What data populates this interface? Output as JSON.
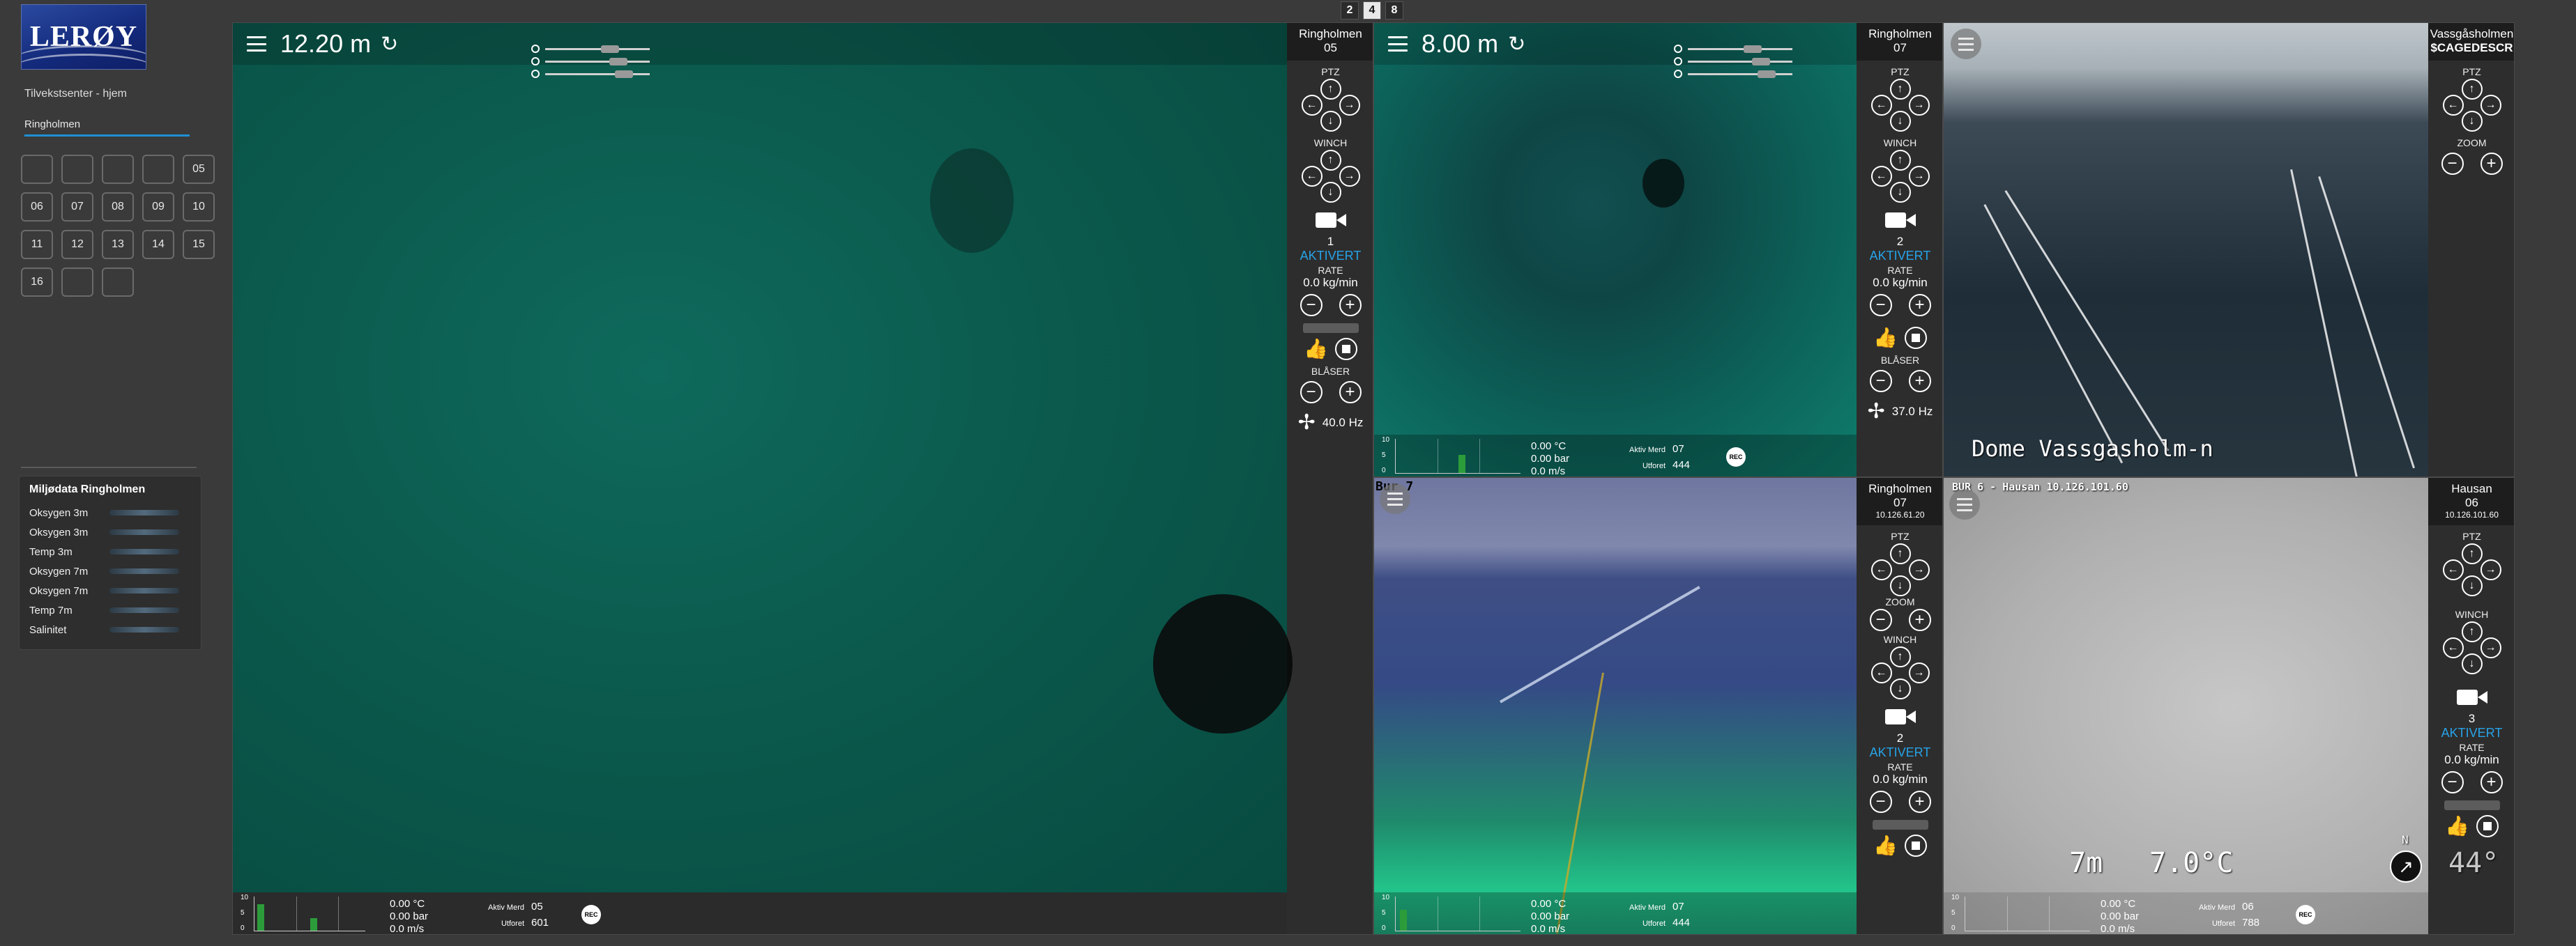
{
  "layout_buttons": [
    {
      "label": "2",
      "active": false
    },
    {
      "label": "4",
      "active": true
    },
    {
      "label": "8",
      "active": false
    }
  ],
  "sidebar": {
    "logo_text": "LERØY",
    "site_link": "Tilvekstsenter - hjem",
    "active_tab": "Ringholmen",
    "cages": [
      "",
      "",
      "",
      "",
      "05",
      "06",
      "07",
      "08",
      "09",
      "10",
      "11",
      "12",
      "13",
      "14",
      "15",
      "16",
      "",
      ""
    ],
    "env": {
      "title": "Miljødata Ringholmen",
      "rows": [
        "Oksygen 3m",
        "Oksygen 3m",
        "Temp 3m",
        "Oksygen 7m",
        "Oksygen 7m",
        "Temp 7m",
        "Salinitet"
      ]
    }
  },
  "cams": [
    {
      "depth": "12.20 m",
      "name": "Ringholmen",
      "cage": "05",
      "feed_num": "1",
      "status": "AKTIVERT",
      "rate_label": "RATE",
      "rate": "0.0 kg/min",
      "ptz_label": "PTZ",
      "winch_label": "WINCH",
      "blower_label": "BLÅSER",
      "blower_hz": "40.0 Hz",
      "temp": "0.00 °C",
      "pressure": "0.00 bar",
      "speed": "0.0 m/s",
      "mort_label": "Aktiv Merd",
      "mort_val": "05",
      "feed_label": "Utforet",
      "feed_val": "601",
      "rec": "REC"
    },
    {
      "depth": "8.00 m",
      "name": "Ringholmen",
      "cage": "07",
      "feed_num": "2",
      "status": "AKTIVERT",
      "rate_label": "RATE",
      "rate": "0.0 kg/min",
      "ptz_label": "PTZ",
      "winch_label": "WINCH",
      "blower_label": "BLÅSER",
      "blower_hz": "37.0 Hz",
      "temp": "0.00 °C",
      "pressure": "0.00 bar",
      "speed": "0.0 m/s",
      "mort_label": "Aktiv Merd",
      "mort_val": "07",
      "feed_label": "Utforet",
      "feed_val": "444",
      "rec": "REC"
    },
    {
      "name": "Vassgåsholmen",
      "sub": "$CAGEDESCR",
      "ptz_label": "PTZ",
      "zoom_label": "ZOOM",
      "osd": "Dome Vassgasholm-n"
    },
    {
      "osd": "Bur 7",
      "name": "Ringholmen",
      "cage": "07",
      "ip": "10.126.61.20",
      "ptz_label": "PTZ",
      "zoom_label": "ZOOM",
      "winch_label": "WINCH",
      "feed_num": "2",
      "status": "AKTIVERT",
      "rate_label": "RATE",
      "rate": "0.0 kg/min",
      "temp": "0.00 °C",
      "pressure": "0.00 bar",
      "speed": "0.0 m/s",
      "mort_label": "Aktiv Merd",
      "mort_val": "07",
      "feed_label": "Utforet",
      "feed_val": "444"
    },
    {
      "osd": "BUR 6 - Hausan  10.126.101.60",
      "name": "Hausan",
      "cage": "06",
      "ip": "10.126.101.60",
      "ptz_label": "PTZ",
      "winch_label": "WINCH",
      "feed_num": "3",
      "status": "AKTIVERT",
      "rate_label": "RATE",
      "rate": "0.0 kg/min",
      "osd_depth": "7m",
      "osd_temp": "7.0°C",
      "osd_heading": "44°",
      "osd_north": "N",
      "temp": "0.00 °C",
      "pressure": "0.00 bar",
      "speed": "0.0 m/s",
      "mort_label": "Aktiv Merd",
      "mort_val": "06",
      "feed_label": "Utforet",
      "feed_val": "788",
      "rec": "REC"
    }
  ],
  "chart_ticks": [
    "10",
    "5",
    "0"
  ],
  "icons": {
    "menu": "hamburger-icon",
    "refresh": "refresh-icon",
    "camera": "camera-switch-icon",
    "thumb": "thumbs-up-icon",
    "stop": "stop-icon",
    "fan": "fan-icon"
  },
  "colors": {
    "accent": "#1e8fd6",
    "active": "#27a3e8",
    "chart_bar": "#2c9c3a"
  }
}
